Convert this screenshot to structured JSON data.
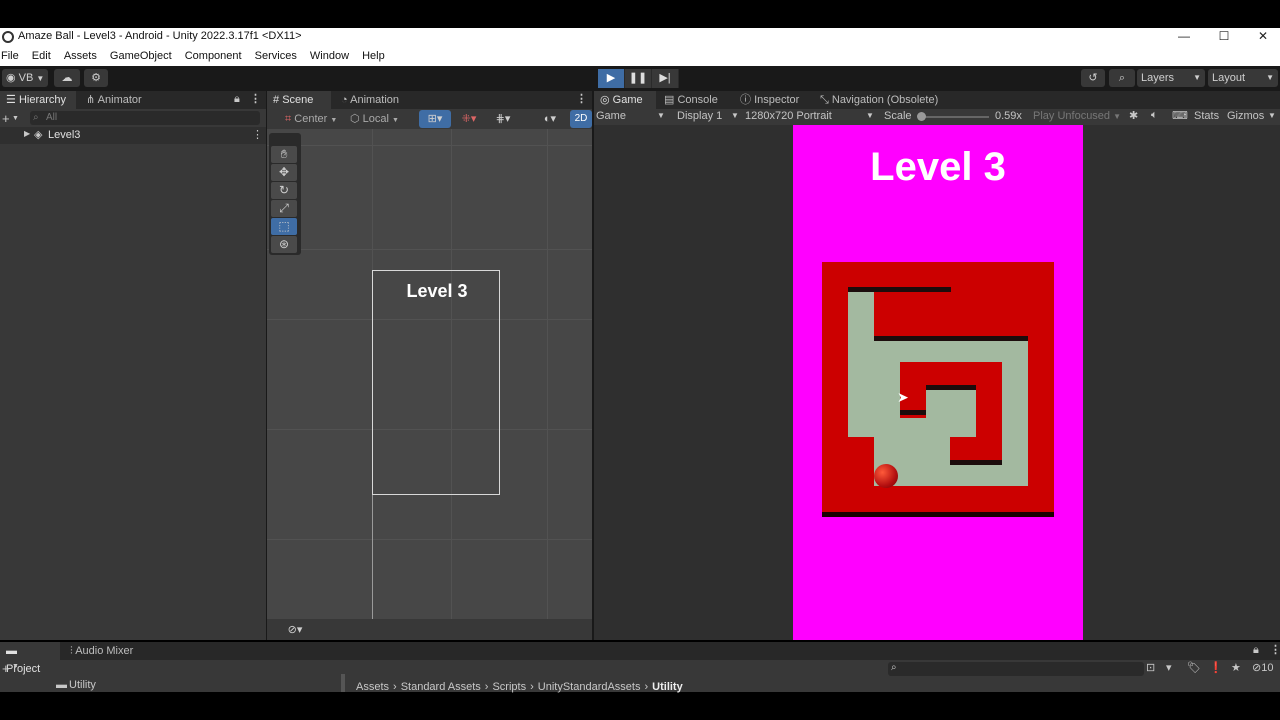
{
  "window": {
    "title": "Amaze Ball - Level3 - Android - Unity 2022.3.17f1 <DX11>"
  },
  "menu": [
    "File",
    "Edit",
    "Assets",
    "GameObject",
    "Component",
    "Services",
    "Window",
    "Help"
  ],
  "toolbar": {
    "account": "VB",
    "layers": "Layers",
    "layout": "Layout"
  },
  "hierarchy": {
    "tabs": [
      "Hierarchy",
      "Animator"
    ],
    "search_placeholder": "All",
    "root_item": "Level3"
  },
  "scene": {
    "tabs": [
      "Scene",
      "Animation"
    ],
    "pivot": "Center",
    "space": "Local",
    "mode_2d": "2D",
    "canvas_label": "Level 3"
  },
  "game": {
    "tabs": [
      "Game",
      "Console",
      "Inspector",
      "Navigation (Obsolete)"
    ],
    "view_mode": "Game",
    "display": "Display 1",
    "resolution": "1280x720 Portrait",
    "scale_label": "Scale",
    "scale_value": "0.59x",
    "play_mode": "Play Unfocused",
    "stats": "Stats",
    "gizmos": "Gizmos",
    "level_title": "Level 3",
    "colors": {
      "background": "#ff00ff",
      "maze_wall": "#cc0000",
      "maze_path": "#a3b9a0",
      "ball": "#d41a1a"
    }
  },
  "project": {
    "tabs": [
      "Project",
      "Audio Mixer"
    ],
    "folder": "Utility",
    "breadcrumb": [
      "Assets",
      "Standard Assets",
      "Scripts",
      "UnityStandardAssets",
      "Utility"
    ],
    "hidden_count": "10"
  }
}
